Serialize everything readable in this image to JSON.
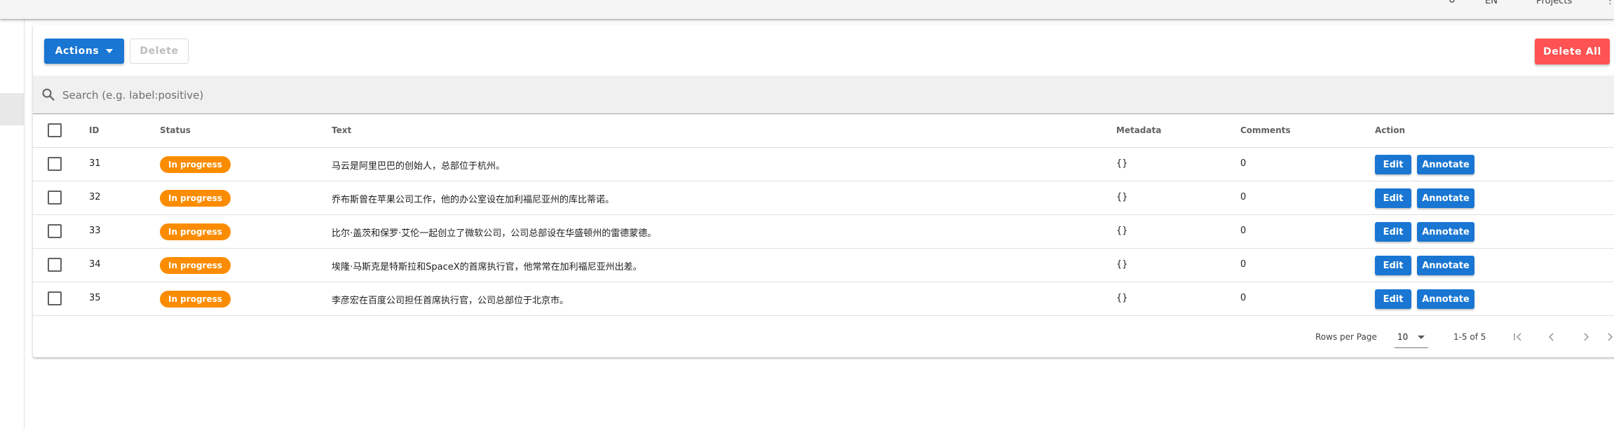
{
  "topbar": {
    "icon": "settings-icon",
    "lang_label": "EN",
    "projects_label": "Projects",
    "more_label": "⋮"
  },
  "sidenav": {
    "active_item": "nav-item"
  },
  "toolbar": {
    "actions_label": "Actions",
    "delete_label": "Delete",
    "delete_all_label": "Delete All"
  },
  "search": {
    "placeholder": "Search (e.g. label:positive)",
    "value": ""
  },
  "table": {
    "headers": {
      "id": "ID",
      "status": "Status",
      "text": "Text",
      "metadata": "Metadata",
      "comments": "Comments",
      "action": "Action"
    },
    "rows": [
      {
        "id": "31",
        "status": "In progress",
        "text": "马云是阿里巴巴的创始人，总部位于杭州。",
        "metadata": "{}",
        "comments": "0"
      },
      {
        "id": "32",
        "status": "In progress",
        "text": "乔布斯曾在苹果公司工作，他的办公室设在加利福尼亚州的库比蒂诺。",
        "metadata": "{}",
        "comments": "0"
      },
      {
        "id": "33",
        "status": "In progress",
        "text": "比尔·盖茨和保罗·艾伦一起创立了微软公司，公司总部设在华盛顿州的雷德蒙德。",
        "metadata": "{}",
        "comments": "0"
      },
      {
        "id": "34",
        "status": "In progress",
        "text": "埃隆·马斯克是特斯拉和SpaceX的首席执行官，他常常在加利福尼亚州出差。",
        "metadata": "{}",
        "comments": "0"
      },
      {
        "id": "35",
        "status": "In progress",
        "text": "李彦宏在百度公司担任首席执行官，公司总部位于北京市。",
        "metadata": "{}",
        "comments": "0"
      }
    ],
    "edit_label": "Edit",
    "annotate_label": "Annotate"
  },
  "footer": {
    "rows_per_page_label": "Rows per Page",
    "rows_per_page_value": "10",
    "range_label": "1-5 of 5"
  },
  "colors": {
    "primary": "#1976d2",
    "error": "#ff5252",
    "status_in_progress": "#fb8c00"
  }
}
